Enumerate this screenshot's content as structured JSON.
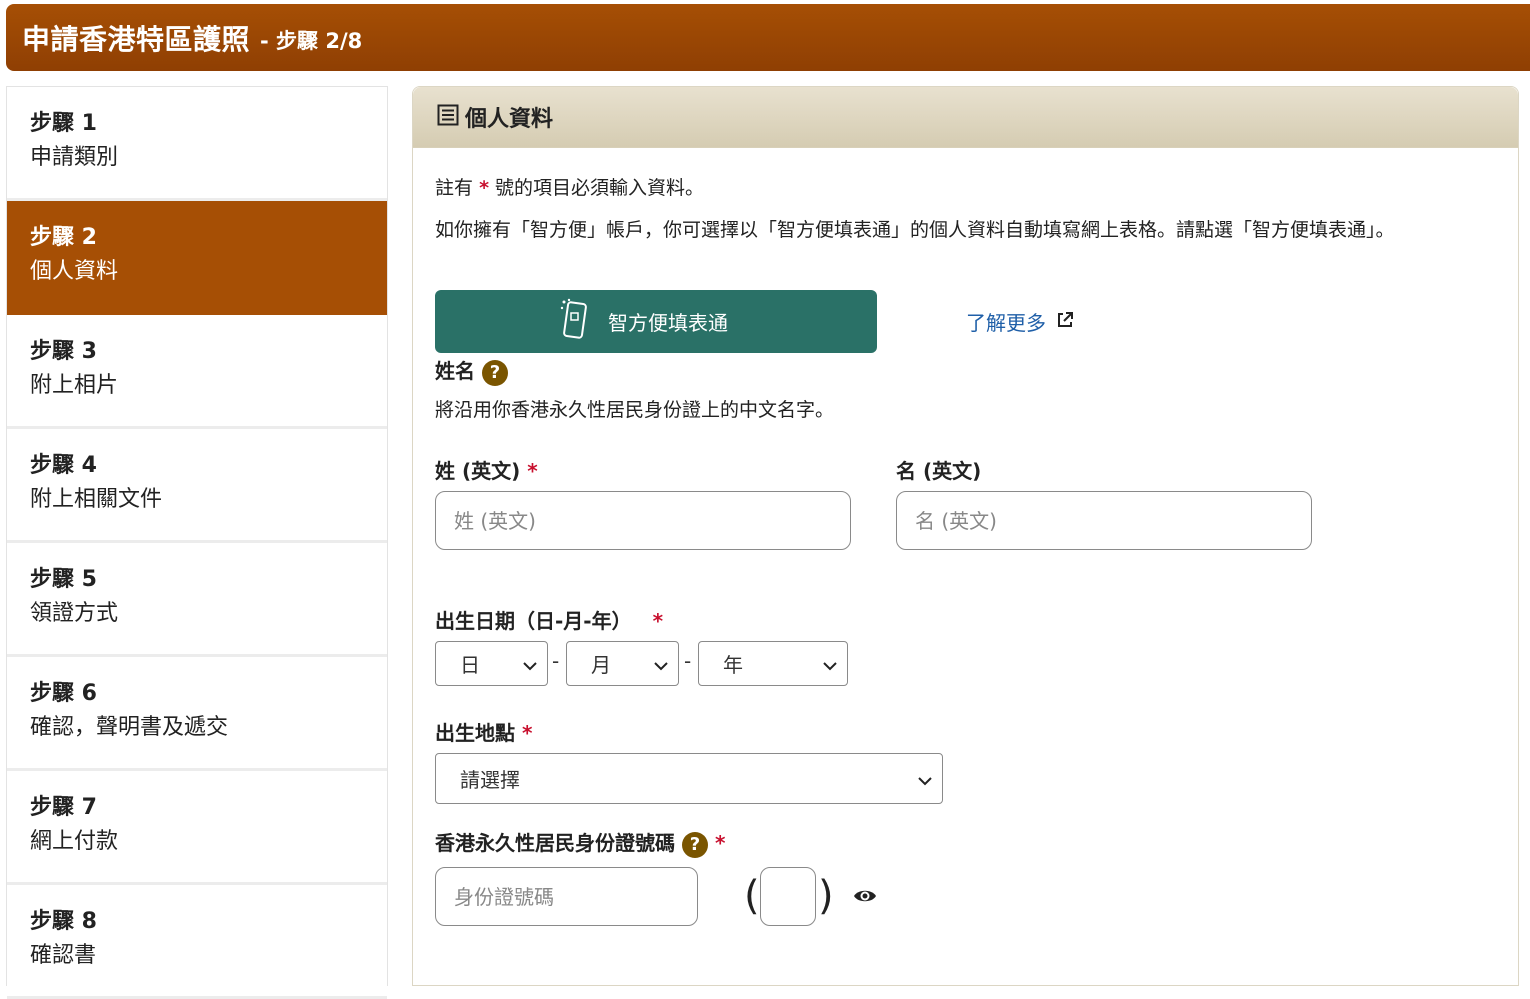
{
  "header": {
    "title": "申請香港特區護照",
    "step": "- 步驟 2/8"
  },
  "sidebar": {
    "items": [
      {
        "num": "步驟 1",
        "label": "申請類別"
      },
      {
        "num": "步驟 2",
        "label": "個人資料"
      },
      {
        "num": "步驟 3",
        "label": "附上相片"
      },
      {
        "num": "步驟 4",
        "label": "附上相關文件"
      },
      {
        "num": "步驟 5",
        "label": "領證方式"
      },
      {
        "num": "步驟 6",
        "label": "確認，聲明書及遞交"
      },
      {
        "num": "步驟 7",
        "label": "網上付款"
      },
      {
        "num": "步驟 8",
        "label": "確認書"
      }
    ]
  },
  "panel": {
    "title": "個人資料",
    "note_prefix": "註有",
    "note_star": "*",
    "note_suffix": "號的項目必須輸入資料。",
    "iam_note": "如你擁有「智方便」帳戶，你可選擇以「智方便填表通」的個人資料自動填寫網上表格。請點選「智方便填表通」。",
    "iam_button": "智方便填表通",
    "learn_more": "了解更多"
  },
  "name_section": {
    "label": "姓名",
    "help": "?",
    "hint": "將沿用你香港永久性居民身份證上的中文名字。",
    "surname_label": "姓 (英文)",
    "surname_placeholder": "姓 (英文)",
    "given_label": "名 (英文)",
    "given_placeholder": "名 (英文)",
    "star": "*"
  },
  "dob": {
    "label": "出生日期（日-月-年）",
    "day": "日",
    "month": "月",
    "year": "年",
    "sep": "-"
  },
  "pob": {
    "label": "出生地點",
    "value": "請選擇"
  },
  "hkid": {
    "label": "香港永久性居民身份證號碼",
    "placeholder": "身份證號碼",
    "open": "(",
    "close": ")"
  },
  "colors": {
    "brand": "#a64f05",
    "iam": "#2a7167",
    "link": "#1f5fa8",
    "required": "#c8102e"
  }
}
